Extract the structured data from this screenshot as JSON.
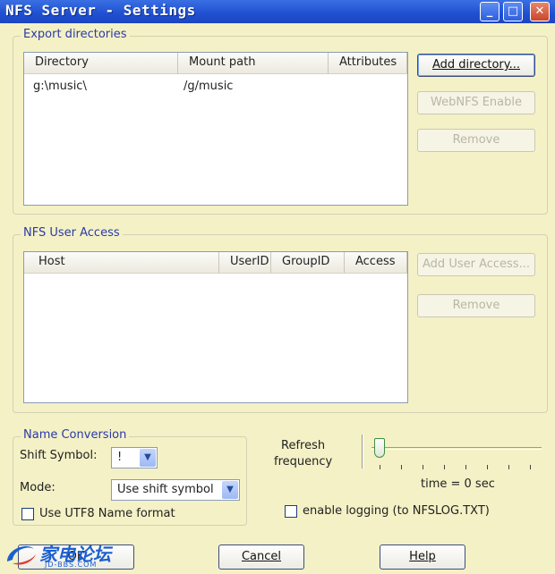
{
  "window": {
    "title": "NFS Server - Settings",
    "controls": {
      "minimize": "_",
      "maximize": "□",
      "close": "✕"
    }
  },
  "export_dirs": {
    "group_label": "Export directories",
    "columns": [
      "Directory",
      "Mount path",
      "Attributes"
    ],
    "rows": [
      {
        "directory": "g:\\music\\",
        "mount_path": "/g/music",
        "attributes": ""
      }
    ],
    "buttons": {
      "add": "Add directory...",
      "webnfs": "WebNFS Enable",
      "remove": "Remove"
    }
  },
  "user_access": {
    "group_label": "NFS User Access",
    "columns": [
      "Host",
      "UserID",
      "GroupID",
      "Access"
    ],
    "rows": [],
    "buttons": {
      "add": "Add User Access...",
      "remove": "Remove"
    }
  },
  "name_conversion": {
    "group_label": "Name Conversion",
    "shift_symbol_label": "Shift Symbol:",
    "shift_symbol_value": "!",
    "mode_label": "Mode:",
    "mode_value": "Use shift symbol",
    "utf8_label": "Use UTF8 Name format",
    "utf8_checked": false
  },
  "refresh": {
    "label_line1": "Refresh",
    "label_line2": "frequency",
    "time_text": "time = 0 sec",
    "slider_value": 0
  },
  "logging": {
    "label": "enable logging (to NFSLOG.TXT)",
    "checked": false
  },
  "footer": {
    "ok": "OK",
    "cancel": "Cancel",
    "help": "Help"
  },
  "watermark": {
    "word": "家电论坛",
    "url": "JD-BBS.COM"
  },
  "colors": {
    "dialog_bg": "#f4f1c6",
    "titlebar": "#1f4fd0",
    "group_label": "#2a3aa8",
    "disabled_text": "#b9b6a6"
  }
}
